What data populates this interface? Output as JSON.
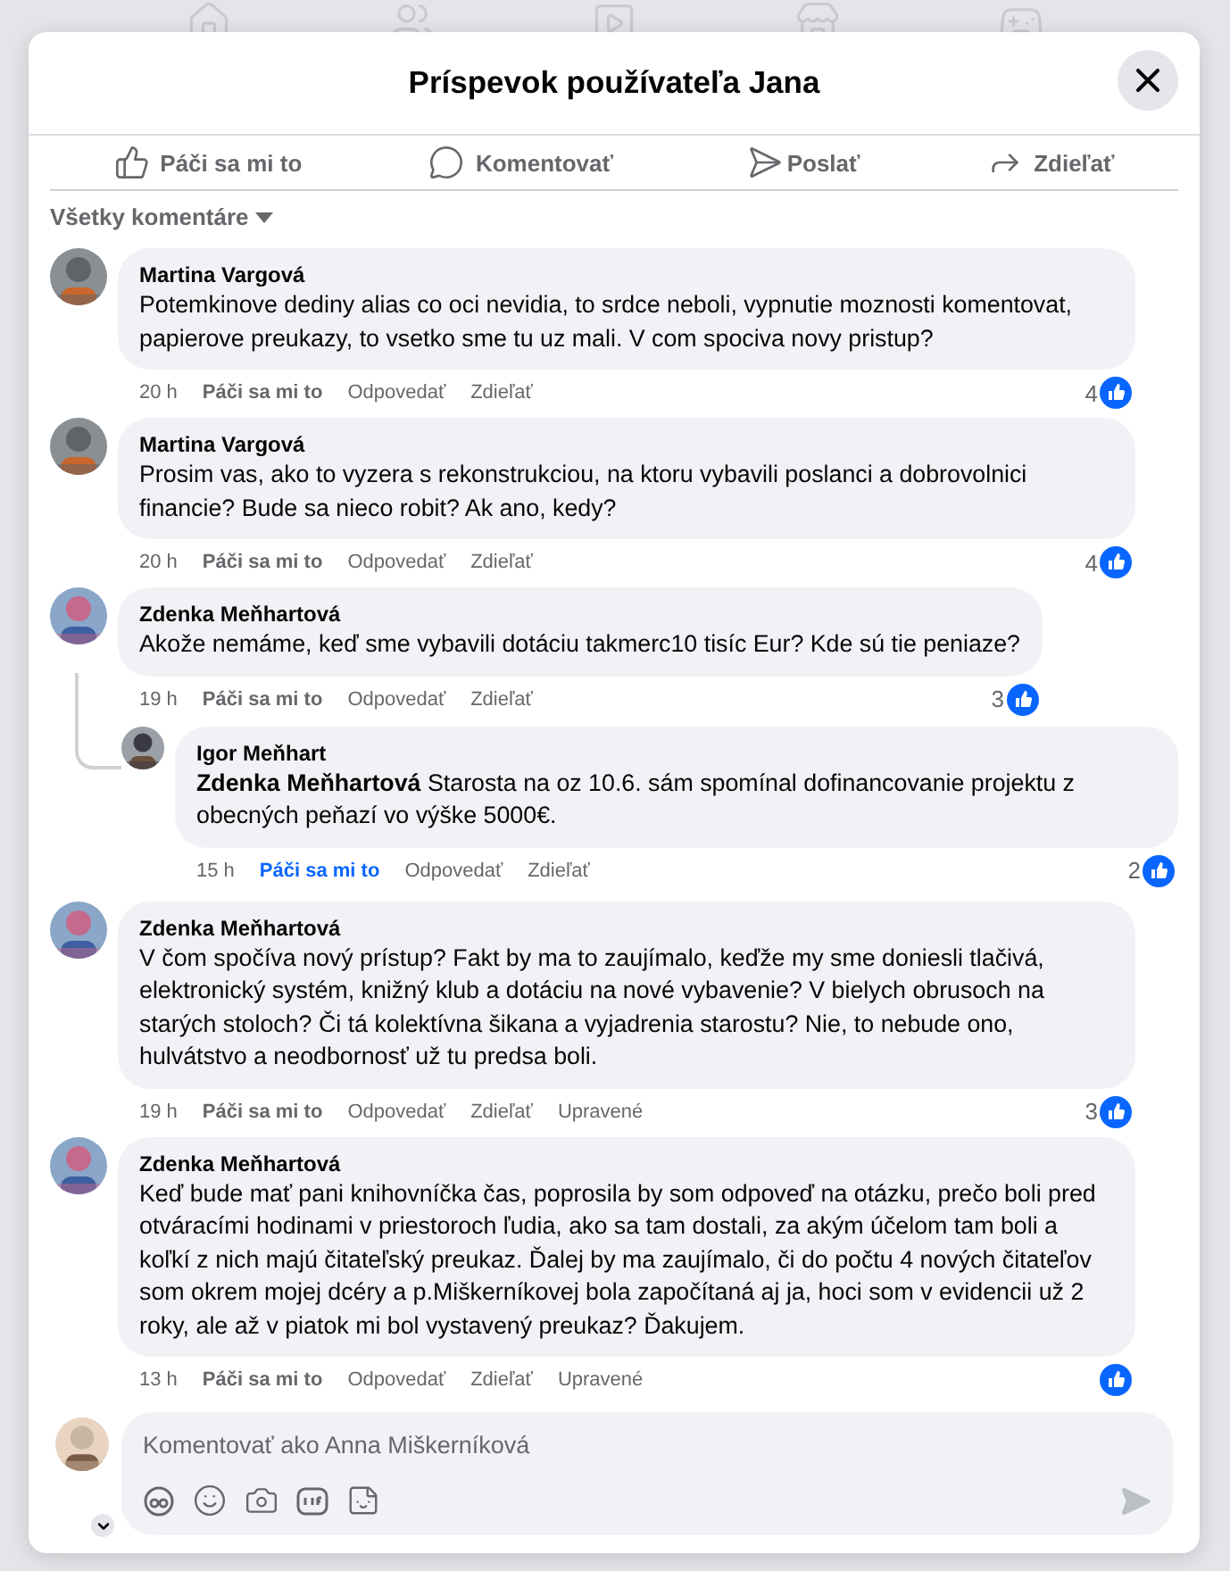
{
  "dialog": {
    "title": "Príspevok používateľa Jana"
  },
  "post_actions": [
    {
      "kind": "like",
      "label": "Páči sa mi to"
    },
    {
      "kind": "comment",
      "label": "Komentovať"
    },
    {
      "kind": "send",
      "label": "Poslať"
    },
    {
      "kind": "share",
      "label": "Zdieľať"
    }
  ],
  "sort": {
    "label": "Všetky komentáre"
  },
  "comments": [
    {
      "author": "Martina Vargová",
      "text": "Potemkinove dediny alias co oci nevidia, to srdce neboli, vypnutie moznosti komentovat, papierove preukazy, to vsetko sme tu uz mali. V com spociva novy pristup?",
      "time": "20 h",
      "like": "Páči sa mi to",
      "liked": false,
      "reply": "Odpovedať",
      "share": "Zdieľať",
      "reactions": "4"
    },
    {
      "author": "Martina Vargová",
      "text": "Prosim vas, ako to vyzera s rekonstrukciou, na ktoru vybavili poslanci a dobrovolnici financie? Bude sa nieco robit? Ak ano, kedy?",
      "time": "20 h",
      "like": "Páči sa mi to",
      "liked": false,
      "reply": "Odpovedať",
      "share": "Zdieľať",
      "reactions": "4"
    },
    {
      "author": "Zdenka Meňhartová",
      "text": "Akože nemáme, keď sme vybavili dotáciu takmerc10 tisíc Eur? Kde sú tie peniaze?",
      "time": "19 h",
      "like": "Páči sa mi to",
      "liked": false,
      "reply": "Odpovedať",
      "share": "Zdieľať",
      "reactions": "3",
      "replies": [
        {
          "author": "Igor Meňhart",
          "text": "**Zdenka Meňhartová** Starosta na oz 10.6. sám spomínal dofinancovanie projektu z obecných peňazí vo výške 5000€.",
          "time": "15 h",
          "like": "Páči sa mi to",
          "liked": true,
          "reply": "Odpovedať",
          "share": "Zdieľať",
          "reactions": "2"
        }
      ]
    },
    {
      "author": "Zdenka Meňhartová",
      "text": "V čom spočíva nový prístup? Fakt by ma to zaujímalo, keďže my sme doniesli tlačivá, elektronický systém, knižný klub a dotáciu na nové vybavenie? V bielych obrusoch na starých stoloch? Či tá kolektívna šikana a vyjadrenia starostu? Nie, to nebude ono, hulvátstvo a neodbornosť už tu predsa boli.",
      "time": "19 h",
      "like": "Páči sa mi to",
      "liked": false,
      "reply": "Odpovedať",
      "share": "Zdieľať",
      "edited": "Upravené",
      "reactions": "3"
    },
    {
      "author": "Zdenka Meňhartová",
      "text": "Keď bude mať pani knihovníčka čas, poprosila by som odpoveď na otázku, prečo boli pred otváracími hodinami v priestoroch ľudia, ako sa tam dostali, za akým účelom tam boli a koľkí z nich majú čitateľský preukaz. Ďalej by ma zaujímalo, či do počtu 4 nových čitateľov som okrem mojej dcéry a p.Miškerníkovej bola započítaná aj ja, hoci som v evidencii už 2 roky, ale až v piatok mi bol vystavený preukaz? Ďakujem.",
      "time": "13 h",
      "like": "Páči sa mi to",
      "liked": false,
      "reply": "Odpovedať",
      "share": "Zdieľať",
      "edited": "Upravené"
    }
  ],
  "composer": {
    "placeholder": "Komentovať ako Anna Miškerníková"
  }
}
